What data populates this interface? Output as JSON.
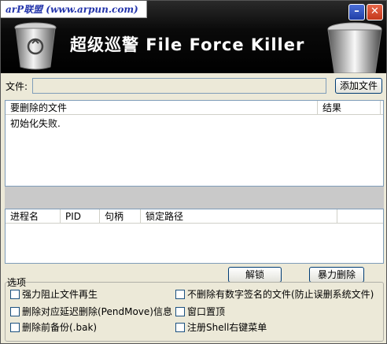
{
  "window": {
    "banner_site": "arP联盟 (www.arpun.com)",
    "title": "超级巡警 File Force Killer",
    "min_glyph": "–",
    "close_glyph": "✕"
  },
  "file_row": {
    "label": "文件:",
    "value": "",
    "add_button": "添加文件"
  },
  "file_list": {
    "columns": [
      "要删除的文件",
      "结果"
    ],
    "rows": [
      "初始化失败."
    ]
  },
  "process_list": {
    "columns": [
      "进程名",
      "PID",
      "句柄",
      "锁定路径"
    ]
  },
  "actions": {
    "unlock": "解锁",
    "force_delete": "暴力删除"
  },
  "options": {
    "label": "选项",
    "items": [
      "强力阻止文件再生",
      "不删除有数字签名的文件(防止误删系统文件)",
      "删除对应延迟删除(PendMove)信息",
      "窗口置顶",
      "删除前备份(.bak)",
      "注册Shell右键菜单"
    ]
  },
  "icons": [
    "recycle-bin-icon",
    "minimize-icon",
    "close-icon"
  ]
}
